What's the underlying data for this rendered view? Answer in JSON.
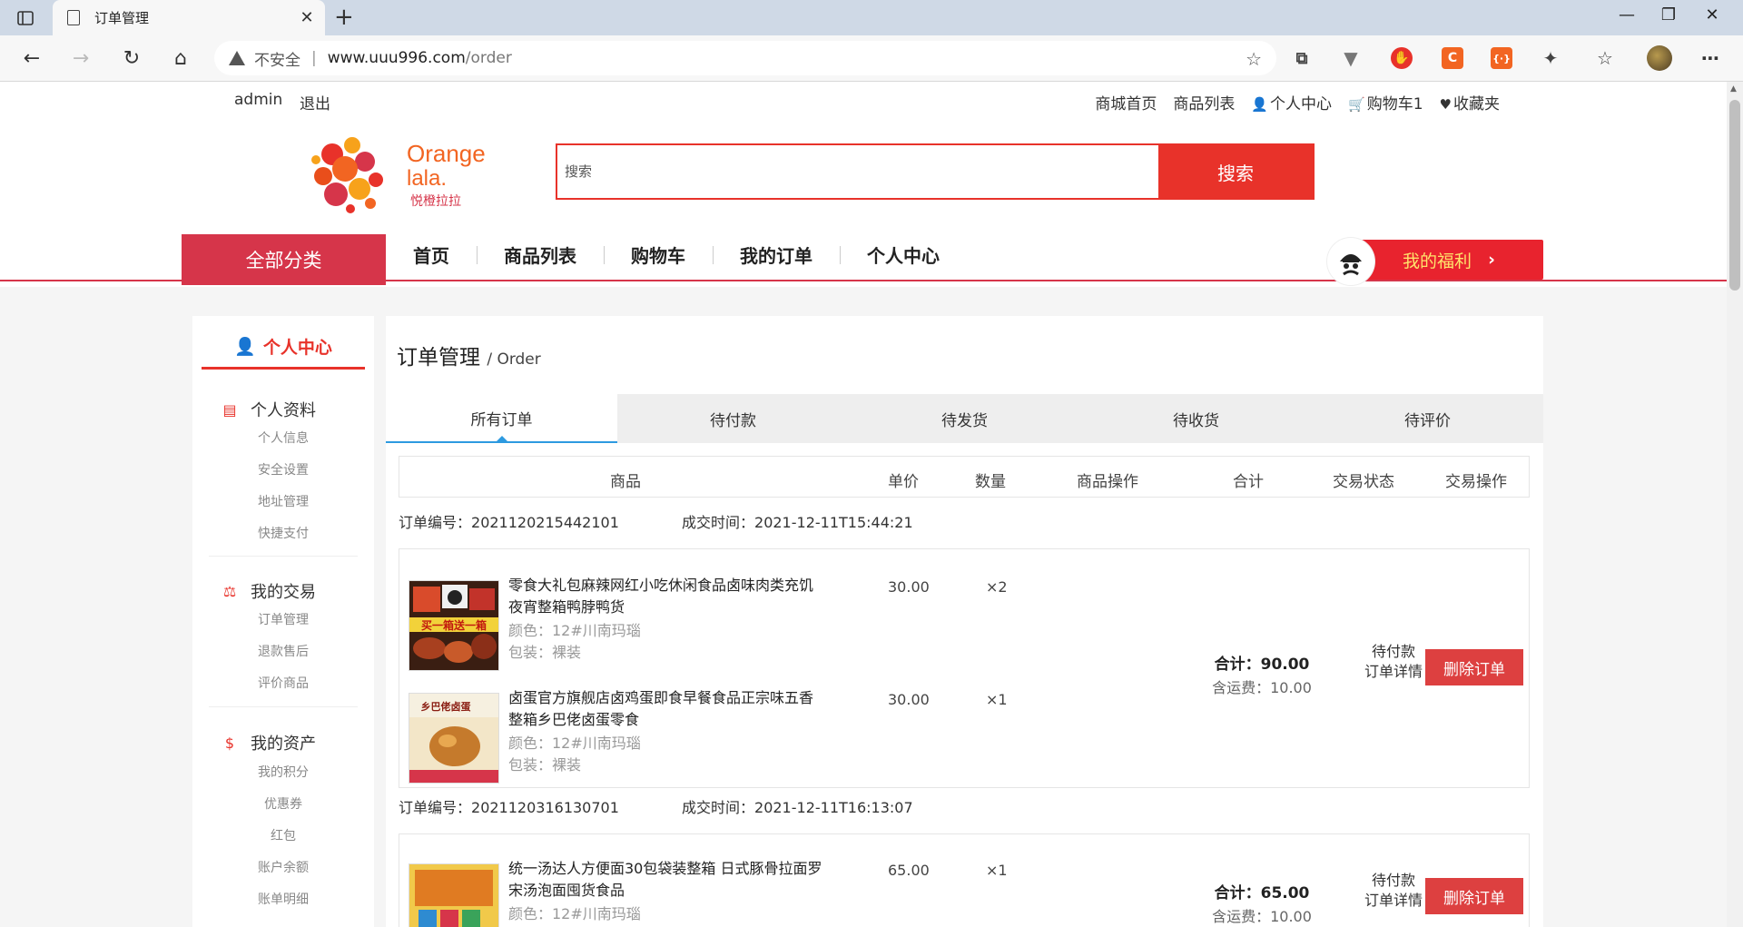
{
  "browser": {
    "tab_title": "订单管理",
    "insecure_label": "不安全",
    "url_host": "www.uuu996.com",
    "url_path": "/order"
  },
  "topbar": {
    "username": "admin",
    "logout": "退出",
    "links": [
      "商城首页",
      "商品列表",
      "个人中心",
      "购物车1",
      "收藏夹"
    ]
  },
  "logo": {
    "line1": "Orange",
    "line2": "lala.",
    "cn": "悦橙拉拉"
  },
  "search": {
    "placeholder": "搜索",
    "button": "搜索"
  },
  "mainnav": {
    "all_categories": "全部分类",
    "items": [
      "首页",
      "商品列表",
      "购物车",
      "我的订单",
      "个人中心"
    ],
    "welfare": "我的福利",
    "welfare_arrow": "›"
  },
  "sidebar": {
    "title": "个人中心",
    "groups": [
      {
        "title": "个人资料",
        "items": [
          "个人信息",
          "安全设置",
          "地址管理",
          "快捷支付"
        ]
      },
      {
        "title": "我的交易",
        "items": [
          "订单管理",
          "退款售后",
          "评价商品"
        ]
      },
      {
        "title": "我的资产",
        "items": [
          "我的积分",
          "优惠券",
          "红包",
          "账户余额",
          "账单明细"
        ]
      }
    ]
  },
  "content": {
    "title": "订单管理",
    "subtitle": "/ Order",
    "tabs": [
      "所有订单",
      "待付款",
      "待发货",
      "待收货",
      "待评价"
    ],
    "columns": [
      "商品",
      "单价",
      "数量",
      "商品操作",
      "合计",
      "交易状态",
      "交易操作"
    ],
    "order_no_label": "订单编号：",
    "time_label": "成交时间：",
    "orders": [
      {
        "no": "2021120215442101",
        "time": "2021-12-11T15:44:21",
        "items": [
          {
            "name": "零食大礼包麻辣网红小吃休闲食品卤味肉类充饥夜宵整箱鸭脖鸭货",
            "color": "颜色：12#川南玛瑙",
            "pack": "包装：裸装",
            "price": "30.00",
            "qty": "×2",
            "thumb_text": "买一箱送一箱"
          },
          {
            "name": "卤蛋官方旗舰店卤鸡蛋即食早餐食品正宗味五香整箱乡巴佬卤蛋零食",
            "color": "颜色：12#川南玛瑙",
            "pack": "包装：裸装",
            "price": "30.00",
            "qty": "×1",
            "thumb_text": "乡巴佬卤蛋"
          }
        ],
        "total": "合计：90.00",
        "shipping": "含运费：10.00",
        "status": "待付款",
        "detail": "订单详情",
        "action": "删除订单"
      },
      {
        "no": "2021120316130701",
        "time": "2021-12-11T16:13:07",
        "items": [
          {
            "name": "统一汤达人方便面30包袋装整箱 日式豚骨拉面罗宋汤泡面囤货食品",
            "color": "颜色：12#川南玛瑙",
            "price": "65.00",
            "qty": "×1"
          }
        ],
        "total": "合计：65.00",
        "shipping": "含运费：10.00",
        "status": "待付款",
        "detail": "订单详情",
        "action": "删除订单"
      }
    ]
  }
}
